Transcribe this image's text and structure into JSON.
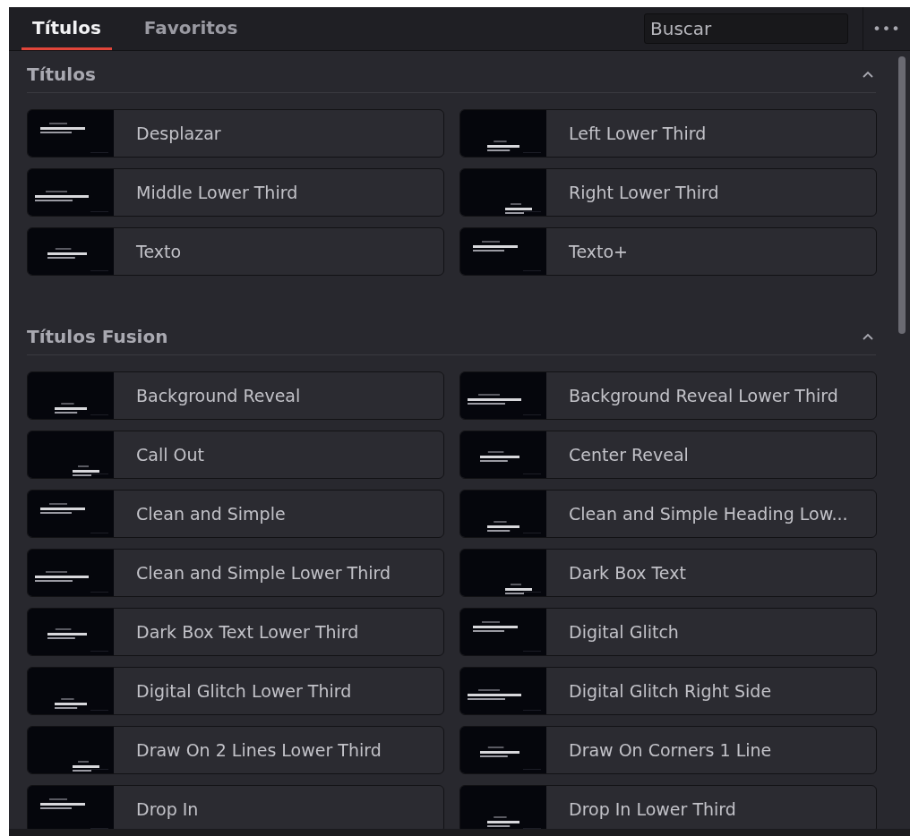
{
  "tabs": [
    {
      "label": "Títulos",
      "selected": true
    },
    {
      "label": "Favoritos",
      "selected": false
    }
  ],
  "search": {
    "placeholder": "Buscar"
  },
  "menu_button": {
    "label": "•••"
  },
  "sections": [
    {
      "title": "Títulos",
      "expanded": true,
      "items": [
        {
          "label": "Desplazar"
        },
        {
          "label": "Left Lower Third"
        },
        {
          "label": "Middle Lower Third"
        },
        {
          "label": "Right Lower Third"
        },
        {
          "label": "Texto"
        },
        {
          "label": "Texto+"
        }
      ]
    },
    {
      "title": "Títulos Fusion",
      "expanded": true,
      "items": [
        {
          "label": "Background Reveal"
        },
        {
          "label": "Background Reveal Lower Third"
        },
        {
          "label": "Call Out"
        },
        {
          "label": "Center Reveal"
        },
        {
          "label": "Clean and Simple"
        },
        {
          "label": "Clean and Simple Heading Low..."
        },
        {
          "label": "Clean and Simple Lower Third"
        },
        {
          "label": "Dark Box Text"
        },
        {
          "label": "Dark Box Text Lower Third"
        },
        {
          "label": "Digital Glitch"
        },
        {
          "label": "Digital Glitch Lower Third"
        },
        {
          "label": "Digital Glitch Right Side"
        },
        {
          "label": "Draw On 2 Lines Lower Third"
        },
        {
          "label": "Draw On Corners 1 Line"
        },
        {
          "label": "Drop In"
        },
        {
          "label": "Drop In Lower Third"
        }
      ]
    }
  ]
}
